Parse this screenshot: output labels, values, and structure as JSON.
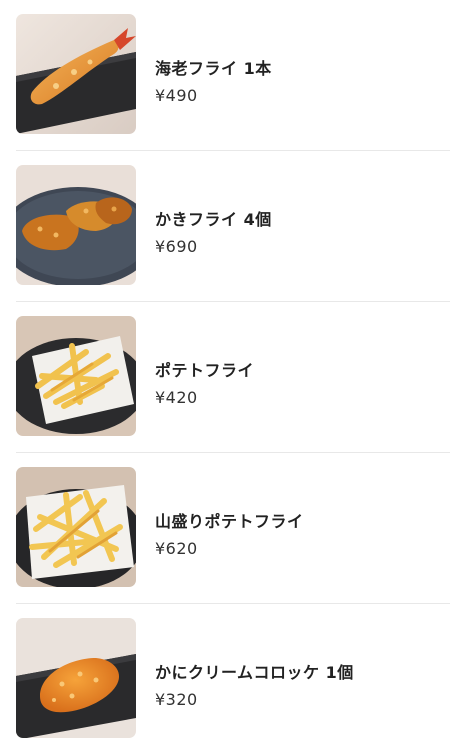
{
  "menu": {
    "items": [
      {
        "name": "海老フライ 1本",
        "price": "¥490",
        "image": "fried-shrimp-image"
      },
      {
        "name": "かきフライ 4個",
        "price": "¥690",
        "image": "fried-oysters-image"
      },
      {
        "name": "ポテトフライ",
        "price": "¥420",
        "image": "french-fries-image"
      },
      {
        "name": "山盛りポテトフライ",
        "price": "¥620",
        "image": "large-french-fries-image"
      },
      {
        "name": "かにクリームコロッケ 1個",
        "price": "¥320",
        "image": "crab-cream-croquette-image"
      }
    ]
  }
}
